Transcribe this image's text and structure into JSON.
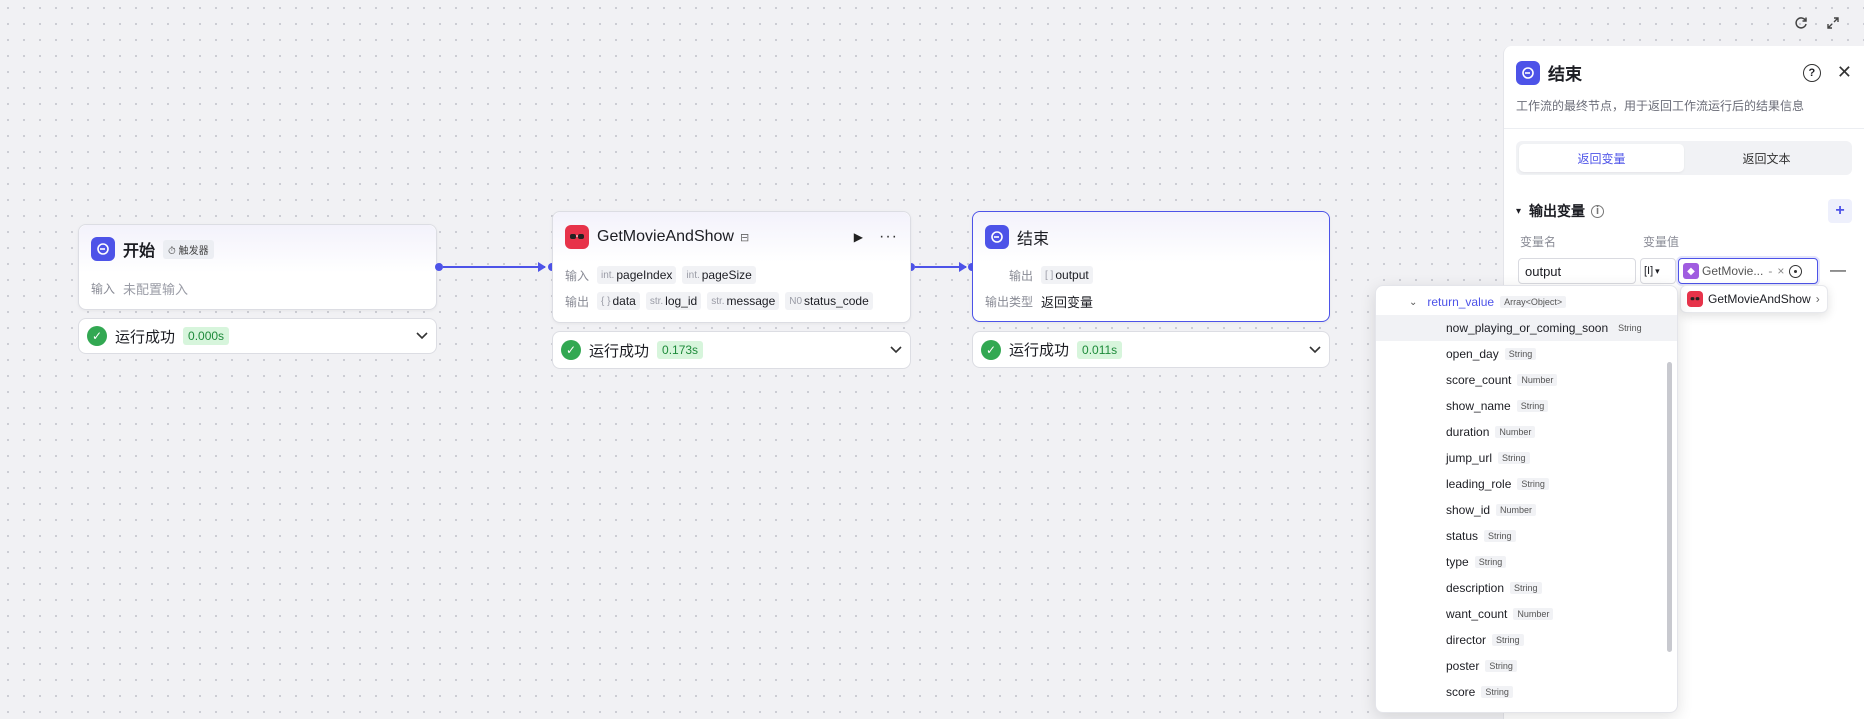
{
  "canvas": {
    "refresh_icon": "refresh-icon",
    "fullscreen_icon": "expand-icon"
  },
  "start_node": {
    "title": "开始",
    "badge": "触发器",
    "input_label": "输入",
    "input_value": "未配置输入",
    "status_text": "运行成功",
    "status_time": "0.000s"
  },
  "movie_node": {
    "title": "GetMovieAndShow",
    "input_label": "输入",
    "output_label": "输出",
    "inputs": [
      {
        "type": "int.",
        "name": "pageIndex"
      },
      {
        "type": "int.",
        "name": "pageSize"
      }
    ],
    "outputs": [
      {
        "type": "{ }",
        "name": "data"
      },
      {
        "type": "str.",
        "name": "log_id"
      },
      {
        "type": "str.",
        "name": "message"
      },
      {
        "type": "N0",
        "name": "status_code"
      }
    ],
    "status_text": "运行成功",
    "status_time": "0.173s"
  },
  "end_node": {
    "title": "结束",
    "output_label": "输出",
    "output_tag_type": "[ ]",
    "output_tag_name": "output",
    "output_type_label": "输出类型",
    "output_type_value": "返回变量",
    "status_text": "运行成功",
    "status_time": "0.011s"
  },
  "panel": {
    "title": "结束",
    "description": "工作流的最终节点，用于返回工作流运行后的结果信息",
    "tabs": [
      "返回变量",
      "返回文本"
    ],
    "active_tab": 0,
    "section_title": "输出变量",
    "col_name": "变量名",
    "col_value": "变量值",
    "var_name": "output",
    "var_type": "[I]",
    "ref_text": "GetMovie...",
    "ref_sep": "-",
    "ref_clear": "×"
  },
  "popover": {
    "label": "GetMovieAndShow"
  },
  "dropdown": {
    "root": {
      "name": "return_value",
      "type": "Array<Object>"
    },
    "items": [
      {
        "name": "now_playing_or_coming_soon",
        "type": "String"
      },
      {
        "name": "open_day",
        "type": "String"
      },
      {
        "name": "score_count",
        "type": "Number"
      },
      {
        "name": "show_name",
        "type": "String"
      },
      {
        "name": "duration",
        "type": "Number"
      },
      {
        "name": "jump_url",
        "type": "String"
      },
      {
        "name": "leading_role",
        "type": "String"
      },
      {
        "name": "show_id",
        "type": "Number"
      },
      {
        "name": "status",
        "type": "String"
      },
      {
        "name": "type",
        "type": "String"
      },
      {
        "name": "description",
        "type": "String"
      },
      {
        "name": "want_count",
        "type": "Number"
      },
      {
        "name": "director",
        "type": "String"
      },
      {
        "name": "poster",
        "type": "String"
      },
      {
        "name": "score",
        "type": "String"
      }
    ]
  },
  "colors": {
    "accent": "#4d53e8",
    "success": "#32a852",
    "plugin_red": "#e7334a"
  }
}
